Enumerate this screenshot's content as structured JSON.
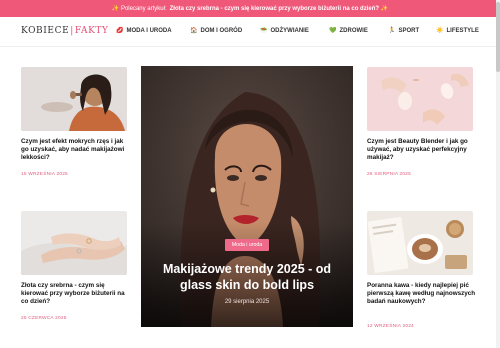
{
  "promo": {
    "prefix": "✨ Polecany artykuł:",
    "link": "Złota czy srebrna - czym się kierować przy wyborze biżuterii na co dzień? ✨"
  },
  "logo": {
    "main": "KOBIECE",
    "sep": "|",
    "accent": "FAKTY"
  },
  "nav": [
    {
      "icon": "💋",
      "label": "MODA I URODA"
    },
    {
      "icon": "🏠",
      "label": "DOM I OGRÓD"
    },
    {
      "icon": "🥗",
      "label": "ODŻYWIANIE"
    },
    {
      "icon": "💚",
      "label": "ZDROWIE"
    },
    {
      "icon": "🏃",
      "label": "SPORT"
    },
    {
      "icon": "☀️",
      "label": "LIFESTYLE"
    }
  ],
  "articles": {
    "top_left": {
      "title": "Czym jest efekt mokrych rzęs i jak go uzyskać, aby nadać makijażowi lekkości?",
      "date": "15 WRZEŚNIA 2025"
    },
    "bottom_left": {
      "title": "Złota czy srebrna - czym się kierować przy wyborze biżuterii na co dzień?",
      "date": "25 CZERWCA 2025"
    },
    "top_right": {
      "title": "Czym jest Beauty Blender i jak go używać, aby uzyskać perfekcyjny makijaż?",
      "date": "26 SIERPNIA 2025"
    },
    "bottom_right": {
      "title": "Poranna kawa - kiedy najlepiej pić pierwszą kawę według najnowszych badań naukowych?",
      "date": "12 WRZEŚNIA 2024"
    }
  },
  "hero": {
    "category": "Moda i uroda",
    "title": "Makijażowe trendy 2025 - od glass skin do bold lips",
    "date": "29 sierpnia 2025"
  }
}
